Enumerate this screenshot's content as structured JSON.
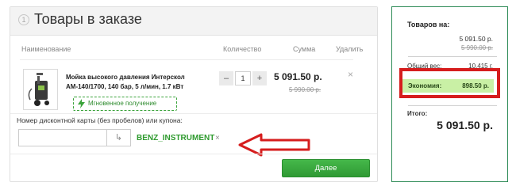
{
  "order": {
    "step": "1",
    "title": "Товары в заказе",
    "columns": {
      "name": "Наименование",
      "qty": "Количество",
      "sum": "Сумма",
      "remove": "Удалить"
    },
    "item": {
      "name": "Мойка высокого давления Интерскол АМ-140/1700, 140 бар, 5 л/мин, 1.7 кВт",
      "instant": "Мгновенное получение",
      "qty_minus": "–",
      "qty": "1",
      "qty_plus": "+",
      "price": "5 091.50 р.",
      "old_price": "5 990.00 р.",
      "remove": "×"
    },
    "discount": {
      "label": "Номер дисконтной карты (без пробелов) или купона:",
      "input_value": "",
      "apply": "↳",
      "coupon": "BENZ_INSTRUMENT",
      "coupon_remove": "×"
    },
    "next_label": "Далее",
    "colors": {
      "accent_green": "#2e9a2e",
      "annotation_red": "#d61d1d"
    }
  },
  "summary": {
    "items_label": "Товаров на:",
    "items_total": "5 091.50 р.",
    "items_old": "5 990.00 р.",
    "weight_label": "Общий вес:",
    "weight_value": "10.415 г.",
    "economy_label": "Экономия:",
    "economy_value": "898.50 р.",
    "total_label": "Итого:",
    "total_value": "5 091.50 р."
  }
}
